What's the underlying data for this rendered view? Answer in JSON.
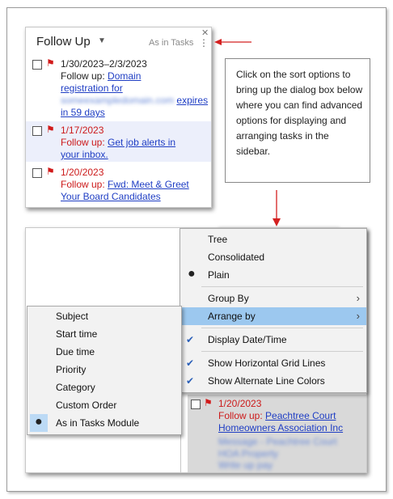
{
  "follow_up_panel": {
    "title": "Follow Up",
    "sort_label": "As in Tasks",
    "tasks": [
      {
        "date": "1/30/2023–2/3/2023",
        "prefix": "Follow up:",
        "link1": "Domain",
        "link2": "registration for",
        "blurred": "someexampledomain.com",
        "link3": "expires",
        "link4": "in 59 days"
      },
      {
        "date": "1/17/2023",
        "prefix": "Follow up:",
        "link1": "Get job alerts in",
        "link2": "your inbox."
      },
      {
        "date": "1/20/2023",
        "prefix": "Follow up:",
        "link1": "Fwd: Meet & Greet",
        "link2": "Your Board Candidates"
      }
    ]
  },
  "callout": {
    "text": "Click on the sort options to bring up the dialog box below where you can find advanced options for displaying and arranging tasks in the sidebar."
  },
  "main_menu": {
    "items": [
      {
        "label": "Tree"
      },
      {
        "label": "Consolidated"
      },
      {
        "label": "Plain"
      },
      {
        "label": "Group By"
      },
      {
        "label": "Arrange by"
      },
      {
        "label": "Display Date/Time"
      },
      {
        "label": "Show Horizontal Grid Lines"
      },
      {
        "label": "Show Alternate Line Colors"
      }
    ]
  },
  "sub_menu": {
    "items": [
      {
        "label": "Subject"
      },
      {
        "label": "Start time"
      },
      {
        "label": "Due time"
      },
      {
        "label": "Priority"
      },
      {
        "label": "Category"
      },
      {
        "label": "Custom Order"
      },
      {
        "label": "As in Tasks Module"
      }
    ]
  },
  "bottom_task": {
    "date": "1/20/2023",
    "prefix": "Follow up:",
    "link1": "Peachtree Court",
    "link2": "Homeowners Association Inc",
    "blurred1": "Message - Peachtree Court",
    "blurred2": "HOA Property",
    "blurred3": "Write up pay"
  },
  "colors": {
    "flag": "#d11a1a",
    "link": "#1f3ec4",
    "menu_highlight": "#9cc8ef",
    "arrow": "#d42020"
  }
}
